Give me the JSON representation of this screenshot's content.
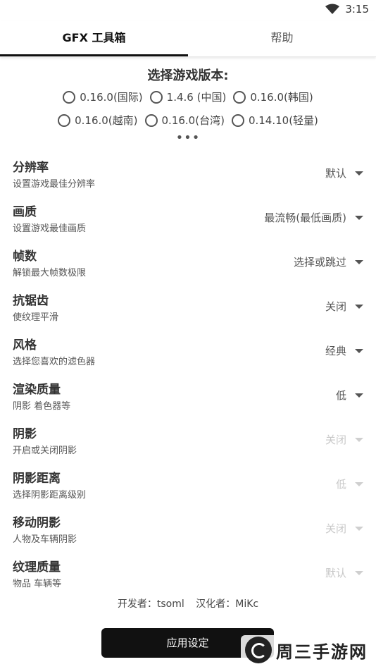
{
  "status": {
    "time": "3:15",
    "wifi_icon": "wifi-icon"
  },
  "tabs": [
    {
      "label": "GFX 工具箱",
      "active": true
    },
    {
      "label": "帮助",
      "active": false
    }
  ],
  "version": {
    "title": "选择游戏版本:",
    "options_row1": [
      "0.16.0(国际)",
      "1.4.6  (中国)",
      "0.16.0(韩国)"
    ],
    "options_row2": [
      "0.16.0(越南)",
      "0.16.0(台湾)",
      "0.14.10(轻量)"
    ],
    "more": "•••"
  },
  "settings": [
    {
      "title": "分辨率",
      "subtitle": "设置游戏最佳分辨率",
      "value": "默认"
    },
    {
      "title": "画质",
      "subtitle": "设置游戏最佳画质",
      "value": "最流畅(最低画质)"
    },
    {
      "title": "帧数",
      "subtitle": "解锁最大帧数极限",
      "value": "选择或跳过"
    },
    {
      "title": "抗锯齿",
      "subtitle": "使纹理平滑",
      "value": "关闭"
    },
    {
      "title": "风格",
      "subtitle": "选择您喜欢的滤色器",
      "value": "经典"
    },
    {
      "title": "渲染质量",
      "subtitle": "阴影 着色器等",
      "value": "低"
    },
    {
      "title": "阴影",
      "subtitle": "开启或关闭阴影",
      "value": "关闭"
    },
    {
      "title": "阴影距离",
      "subtitle": "选择阴影距离级别",
      "value": "低"
    },
    {
      "title": "移动阴影",
      "subtitle": "人物及车辆阴影",
      "value": "关闭"
    },
    {
      "title": "纹理质量",
      "subtitle": "物品 车辆等",
      "value": "默认"
    }
  ],
  "credits": {
    "developer": "开发者：tsoml",
    "translator": "汉化者：MiKc"
  },
  "apply_button": "应用设定",
  "watermark": "周三手游网"
}
